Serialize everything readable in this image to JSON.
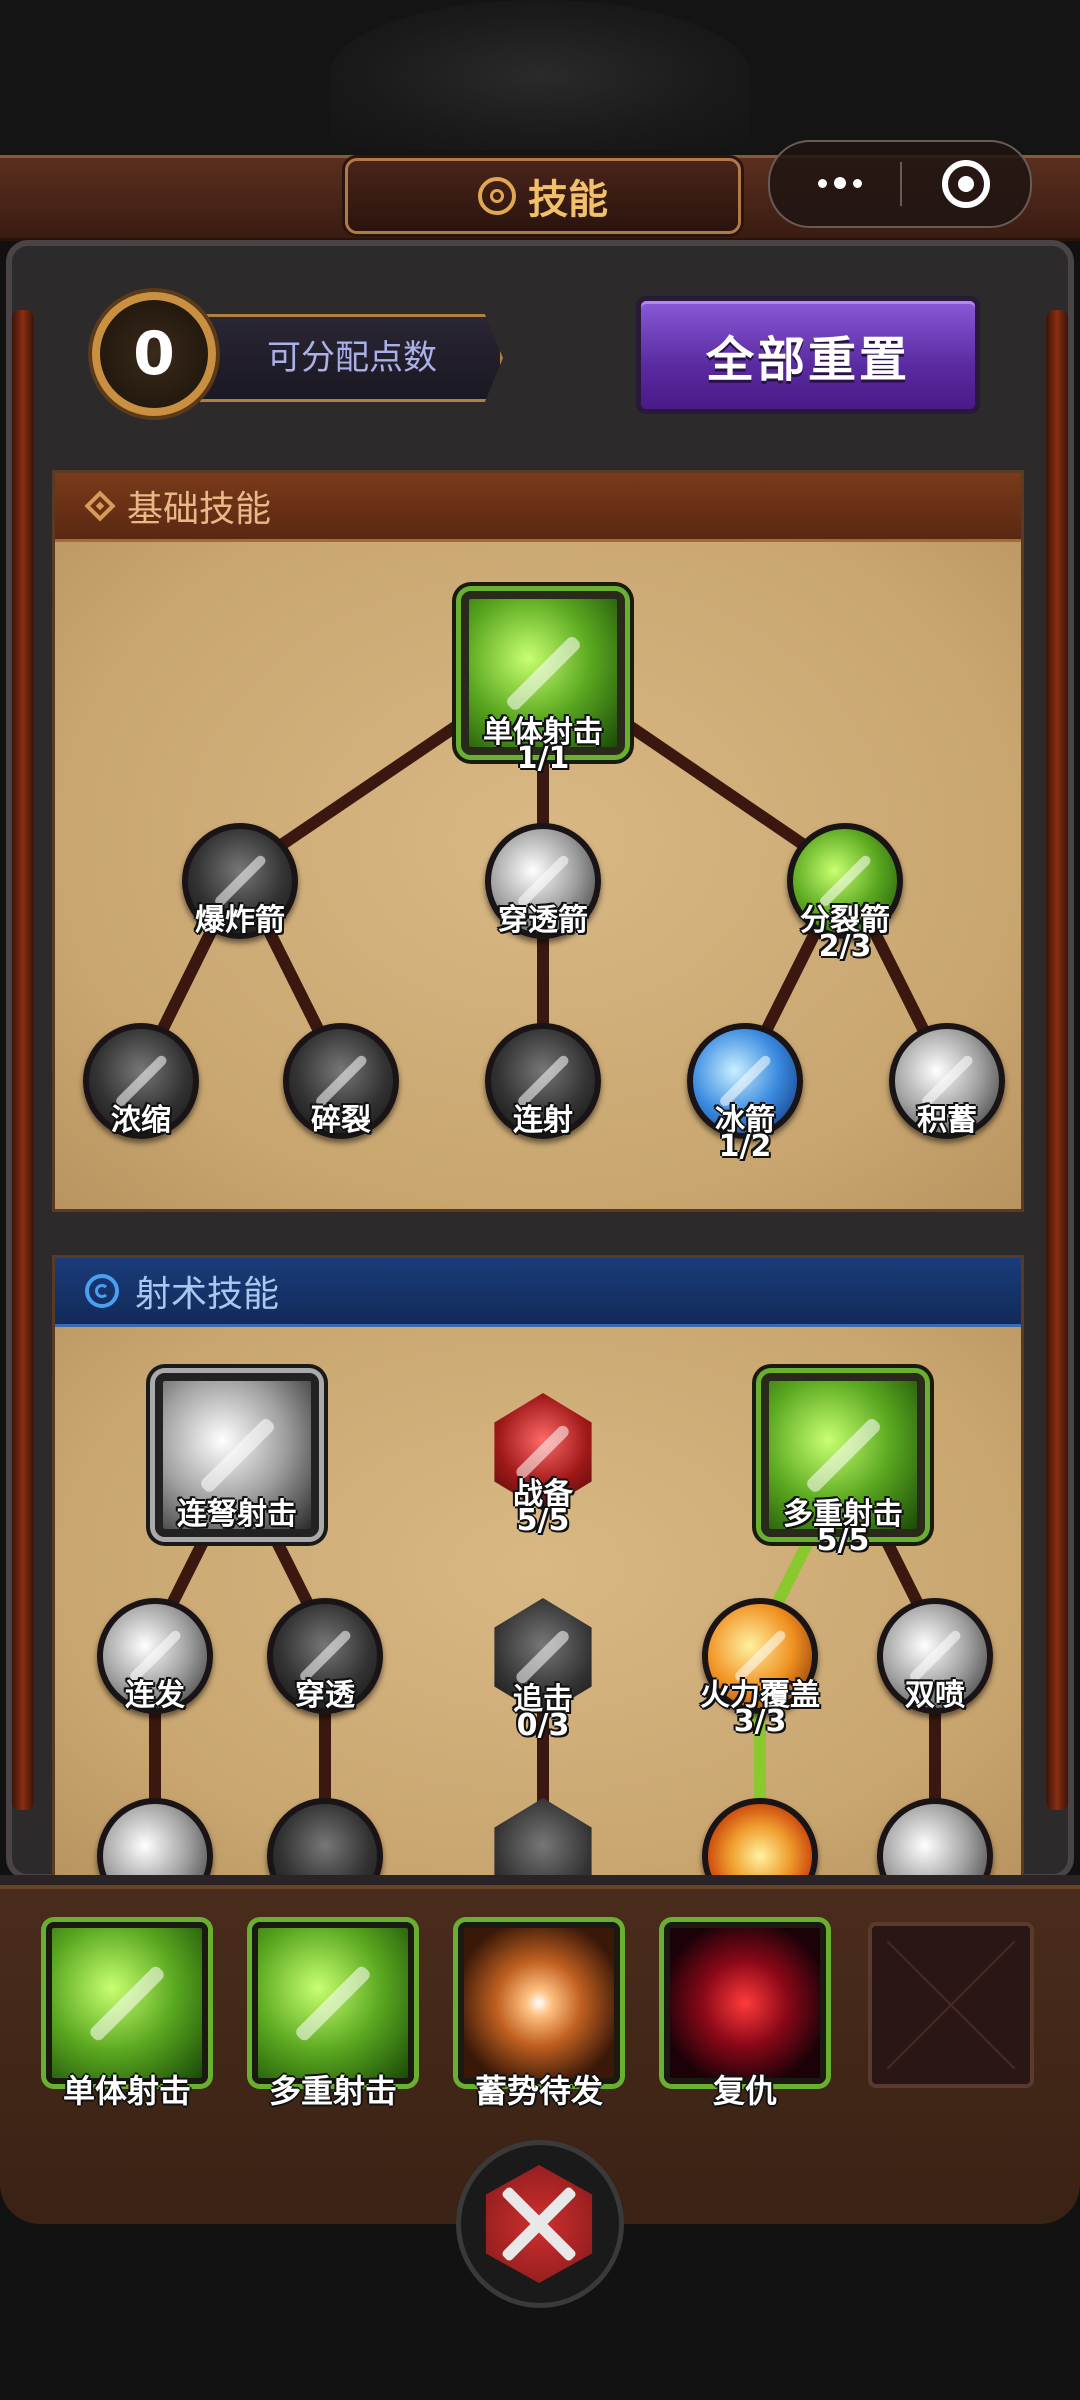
{
  "header": {
    "title": "技能"
  },
  "points": {
    "value": "0",
    "label": "可分配点数"
  },
  "reset_button": {
    "label": "全部重置"
  },
  "sections": {
    "basic": {
      "title": "基础技能",
      "nodes": {
        "single_shot": {
          "name": "单体射击",
          "level": "1/1",
          "icon": "green-arrow-icon"
        },
        "explosive_arrow": {
          "name": "爆炸箭",
          "icon": "explosion-icon"
        },
        "piercing_arrow": {
          "name": "穿透箭",
          "icon": "swirl-arrow-icon"
        },
        "split_arrow": {
          "name": "分裂箭",
          "level": "2/3",
          "icon": "split-arrow-icon"
        },
        "concentrate": {
          "name": "浓缩",
          "icon": "starburst-icon"
        },
        "shatter": {
          "name": "碎裂",
          "icon": "shatter-icon"
        },
        "rapid_fire": {
          "name": "连射",
          "icon": "rapid-fire-icon"
        },
        "ice_arrow": {
          "name": "冰箭",
          "level": "1/2",
          "icon": "ice-arrow-icon"
        },
        "charge_up": {
          "name": "积蓄",
          "icon": "charge-orb-icon"
        }
      }
    },
    "archery": {
      "title": "射术技能",
      "nodes": {
        "crossbow_shot": {
          "name": "连弩射击",
          "icon": "crossbow-icon"
        },
        "battle_ready": {
          "name": "战备",
          "level": "5/5",
          "icon": "battle-ready-icon"
        },
        "multi_shot": {
          "name": "多重射击",
          "level": "5/5",
          "icon": "multi-shot-icon"
        },
        "volley": {
          "name": "连发",
          "icon": "volley-icon"
        },
        "pierce": {
          "name": "穿透",
          "icon": "pierce-icon"
        },
        "pursuit": {
          "name": "追击",
          "level": "0/3",
          "icon": "pursuit-icon"
        },
        "fire_coverage": {
          "name": "火力覆盖",
          "level": "3/3",
          "icon": "fire-coverage-icon"
        },
        "double_spray": {
          "name": "双喷",
          "icon": "double-spray-icon"
        }
      }
    }
  },
  "equipped_slots": [
    {
      "name": "单体射击",
      "icon": "green-arrow-icon"
    },
    {
      "name": "多重射击",
      "icon": "multi-shot-icon"
    },
    {
      "name": "蓄势待发",
      "icon": "galaxy-icon"
    },
    {
      "name": "复仇",
      "icon": "revenge-face-icon"
    },
    {
      "name": "",
      "icon": "empty-slot-icon"
    }
  ],
  "colors": {
    "accent_gold": "#c89040",
    "reset_purple": "#5a2aa0",
    "basic_header": "#7a3a1a",
    "archery_header": "#1a3c7a",
    "active_green": "#6ab030"
  }
}
